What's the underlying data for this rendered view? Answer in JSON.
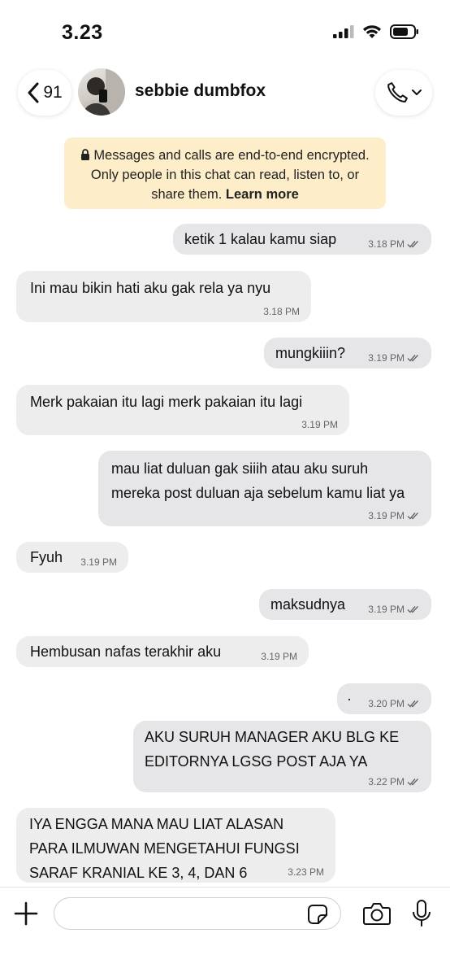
{
  "status": {
    "time": "3.23"
  },
  "header": {
    "back_count": "91",
    "contact_name": "sebbie dumbfox"
  },
  "notice": {
    "text": "Messages and calls are end-to-end encrypted. Only people in this chat can read, listen to, or share them.",
    "link": "Learn more"
  },
  "messages": [
    {
      "direction": "out",
      "text": "ketik 1 kalau kamu siap",
      "time": "3.18 PM"
    },
    {
      "direction": "in",
      "text": "Ini mau bikin hati aku gak rela ya nyu",
      "time": "3.18 PM"
    },
    {
      "direction": "out",
      "text": "mungkiiin?",
      "time": "3.19 PM"
    },
    {
      "direction": "in",
      "text": "Merk pakaian itu lagi merk pakaian itu lagi",
      "time": "3.19 PM"
    },
    {
      "direction": "out",
      "text": "mau liat duluan gak siiih atau aku suruh mereka post duluan aja sebelum kamu liat ya",
      "time": "3.19 PM"
    },
    {
      "direction": "in",
      "text": "Fyuh",
      "time": "3.19 PM"
    },
    {
      "direction": "out",
      "text": "maksudnya",
      "time": "3.19 PM"
    },
    {
      "direction": "in",
      "text": "Hembusan nafas terakhir aku",
      "time": "3.19 PM"
    },
    {
      "direction": "out",
      "text": "·",
      "time": "3.20 PM"
    },
    {
      "direction": "out",
      "text": "AKU SURUH MANAGER AKU BLG KE EDITORNYA LGSG POST AJA YA",
      "time": "3.22 PM"
    },
    {
      "direction": "in",
      "text": "IYA ENGGA MANA MAU LIAT ALASAN PARA ILMUWAN MENGETAHUI FUNGSI SARAF KRANIAL KE 3, 4, DAN 6",
      "time": "3.23 PM"
    }
  ],
  "composer": {
    "placeholder": ""
  },
  "colors": {
    "bubble_out": "#e6e6e8",
    "bubble_in": "#ededee",
    "notice_bg": "#fdedc9"
  }
}
